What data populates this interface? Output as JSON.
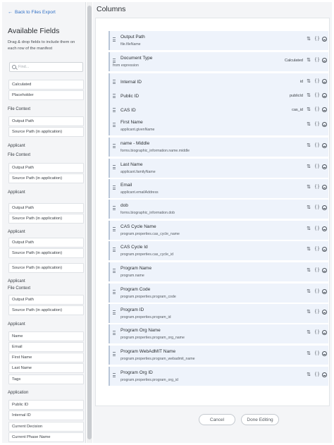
{
  "left": {
    "back_label": "Back to Files Export",
    "title": "Available Fields",
    "description": "Drag & drop fields to include them on each row of the manifest",
    "search_placeholder": "Find...",
    "top_fields": [
      "Calculated",
      "Placeholder"
    ],
    "groups": [
      {
        "label": "File Context",
        "fields": [
          "Output Path",
          "Source Path (in application)"
        ]
      },
      {
        "label": "Applicant",
        "fields": []
      },
      {
        "label": "File Context",
        "fields": [
          "Output Path",
          "Source Path (in application)"
        ]
      },
      {
        "label": "Applicant",
        "fields": []
      },
      {
        "label": "Applicant",
        "fields": [
          "Output Path",
          "Source Path (in application)"
        ]
      },
      {
        "label": "Applicant",
        "fields": [
          "Output Path",
          "Source Path (in application)",
          "Source Path (in application)"
        ]
      },
      {
        "label": "Applicant",
        "fields": []
      },
      {
        "label": "File Context",
        "fields": [
          "Output Path",
          "Source Path (in application)"
        ]
      },
      {
        "label": "Applicant",
        "fields": [
          "Name",
          "Email",
          "First Name",
          "Last Name",
          "Tags"
        ]
      },
      {
        "label": "Application",
        "fields": [
          "Public ID",
          "Internal ID",
          "Current Decision",
          "Current Phase Name"
        ]
      }
    ]
  },
  "right": {
    "title": "Columns",
    "rows": [
      {
        "name": "Output Path",
        "path": "file.fileName",
        "value": ""
      },
      {
        "name": "Document Type",
        "path": "from expression",
        "value": "Calculated"
      },
      {
        "name": "Internal ID",
        "path": "",
        "value": "id"
      },
      {
        "name": "Public ID",
        "path": "",
        "value": "publicId"
      },
      {
        "name": "CAS ID",
        "path": "",
        "value": "cas_id"
      },
      {
        "name": "First Name",
        "path": "applicant.givenName",
        "value": ""
      },
      {
        "name": "name - Middle",
        "path": "forms.biographic_information.name.middle",
        "value": ""
      },
      {
        "name": "Last Name",
        "path": "applicant.familyName",
        "value": ""
      },
      {
        "name": "Email",
        "path": "applicant.emailAddress",
        "value": ""
      },
      {
        "name": "dob",
        "path": "forms.biographic_information.dob",
        "value": ""
      },
      {
        "name": "CAS Cycle Name",
        "path": "program.properties.cas_cycle_name",
        "value": ""
      },
      {
        "name": "CAS Cycle Id",
        "path": "program.properties.cas_cycle_id",
        "value": ""
      },
      {
        "name": "Program Name",
        "path": "program.name",
        "value": ""
      },
      {
        "name": "Program Code",
        "path": "program.properties.program_code",
        "value": ""
      },
      {
        "name": "Program ID",
        "path": "program.properties.program_id",
        "value": ""
      },
      {
        "name": "Program Org Name",
        "path": "program.properties.program_org_name",
        "value": ""
      },
      {
        "name": "Program WebAdMIT Name",
        "path": "program.properties.program_webadmit_name",
        "value": ""
      },
      {
        "name": "Program Org ID",
        "path": "program.properties.program_org_id",
        "value": ""
      }
    ],
    "icons": {
      "swap": "swap-icon",
      "brace": "braces-icon",
      "remove": "remove-circle-icon"
    },
    "cancel_label": "Cancel",
    "done_label": "Done Editing"
  }
}
